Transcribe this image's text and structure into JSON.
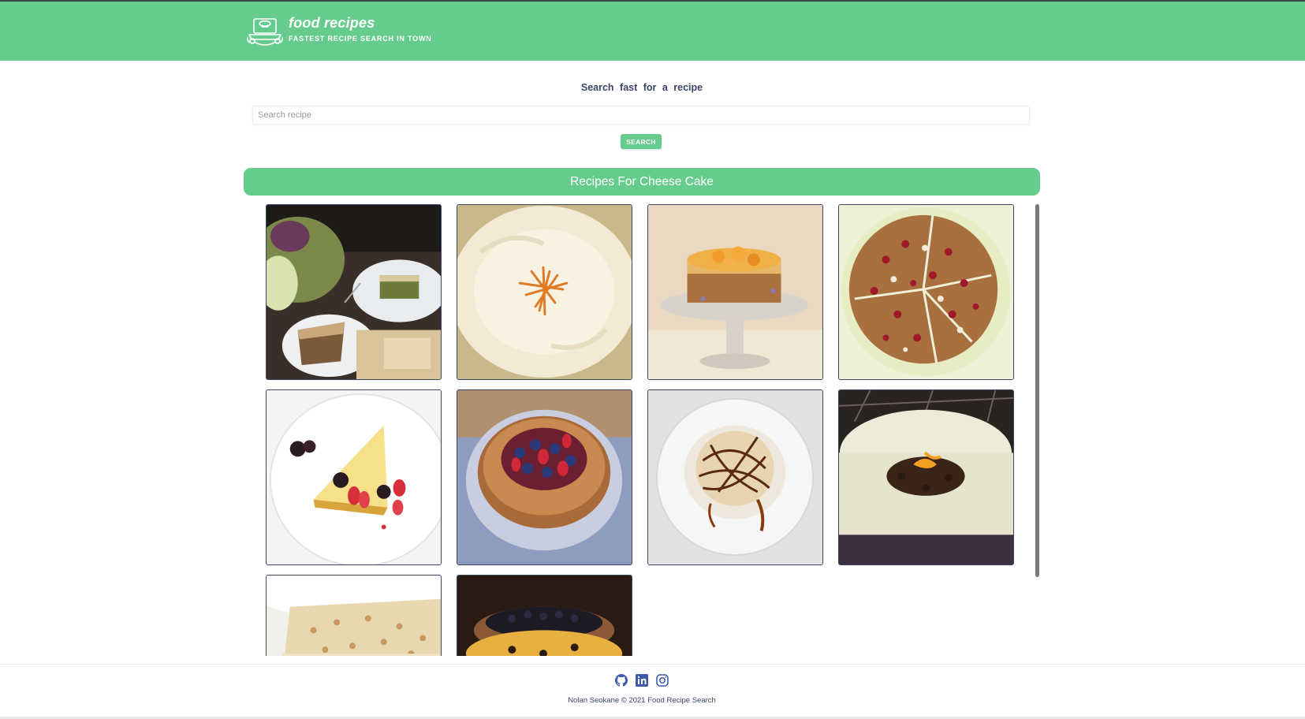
{
  "header": {
    "title": "food recipes",
    "subtitle": "FASTEST RECIPE SEARCH IN TOWN"
  },
  "search": {
    "heading": "Search fast for a recipe",
    "placeholder": "Search recipe",
    "value": "",
    "button_label": "SEARCH"
  },
  "results": {
    "title": "Recipes For Cheese Cake",
    "cards": [
      {
        "image": "savory-cheesecake-slices-platter"
      },
      {
        "image": "cream-topped-cake-orange-zest"
      },
      {
        "image": "orange-topped-cheesecake-on-glass-stand"
      },
      {
        "image": "cranberry-coffee-cake-sliced"
      },
      {
        "image": "cheesecake-slice-with-berries"
      },
      {
        "image": "berry-topped-tart"
      },
      {
        "image": "banana-caramel-cheesecake"
      },
      {
        "image": "white-cheesecake-cookie-crumble"
      },
      {
        "image": "coconut-layer-cake-slice"
      },
      {
        "image": "pear-blueberry-dessert"
      }
    ]
  },
  "footer": {
    "icons": [
      "github-icon",
      "linkedin-icon",
      "instagram-icon"
    ],
    "copyright": "Nolan Seokane © 2021 Food Recipe Search"
  },
  "colors": {
    "accent": "#66cc8d",
    "text_dark": "#3b4466",
    "icon_blue": "#3d5aa8"
  }
}
